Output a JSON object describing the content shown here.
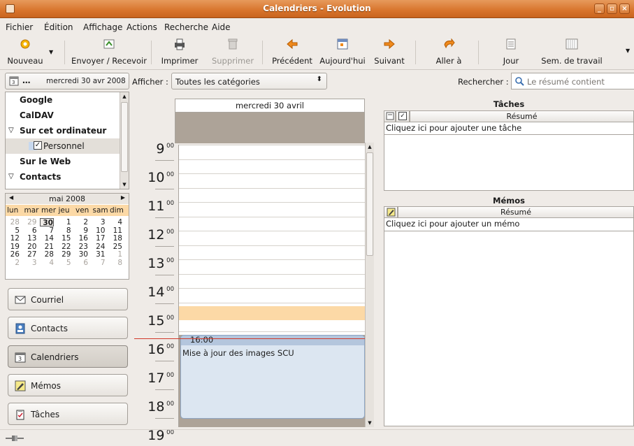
{
  "window": {
    "title": "Calendriers - Evolution"
  },
  "menu": [
    "Fichier",
    "Édition",
    "Affichage",
    "Actions",
    "Recherche",
    "Aide"
  ],
  "toolbar": {
    "new_label": "Nouveau",
    "send_receive_label": "Envoyer / Recevoir",
    "print_label": "Imprimer",
    "delete_label": "Supprimer",
    "previous_label": "Précédent",
    "today_label": "Aujourd'hui",
    "next_label": "Suivant",
    "goto_label": "Aller à",
    "day_label": "Jour",
    "workweek_label": "Sem. de travail"
  },
  "filter": {
    "date_button": "…",
    "current_date": "mercredi 30 avr 2008",
    "show_label": "Afficher :",
    "category_value": "Toutes les catégories",
    "search_label": "Rechercher :",
    "search_scope": "Le résumé contient"
  },
  "sources": [
    {
      "label": "Google",
      "type": "group",
      "expanded": false
    },
    {
      "label": "CalDAV",
      "type": "group",
      "expanded": false
    },
    {
      "label": "Sur cet ordinateur",
      "type": "group",
      "expanded": true
    },
    {
      "label": "Personnel",
      "type": "calendar",
      "checked": true
    },
    {
      "label": "Sur le Web",
      "type": "group",
      "expanded": false
    },
    {
      "label": "Contacts",
      "type": "group",
      "expanded": true
    }
  ],
  "minical": {
    "month_label": "mai 2008",
    "day_headers": [
      "lun",
      "mar",
      "mer",
      "jeu",
      "ven",
      "sam",
      "dim"
    ],
    "weeks": [
      [
        "28",
        "29",
        "30",
        "1",
        "2",
        "3",
        "4"
      ],
      [
        "5",
        "6",
        "7",
        "8",
        "9",
        "10",
        "11"
      ],
      [
        "12",
        "13",
        "14",
        "15",
        "16",
        "17",
        "18"
      ],
      [
        "19",
        "20",
        "21",
        "22",
        "23",
        "24",
        "25"
      ],
      [
        "26",
        "27",
        "28",
        "29",
        "30",
        "31",
        "1"
      ],
      [
        "2",
        "3",
        "4",
        "5",
        "6",
        "7",
        "8"
      ]
    ],
    "today": "30"
  },
  "switcher": [
    {
      "label": "Courriel",
      "icon": "mail-icon",
      "active": false
    },
    {
      "label": "Contacts",
      "icon": "contacts-icon",
      "active": false
    },
    {
      "label": "Calendriers",
      "icon": "calendar-icon",
      "active": true
    },
    {
      "label": "Mémos",
      "icon": "memo-icon",
      "active": false
    },
    {
      "label": "Tâches",
      "icon": "tasks-icon",
      "active": false
    }
  ],
  "dayview": {
    "header": "mercredi 30 avril",
    "hours": [
      "9",
      "10",
      "11",
      "12",
      "13",
      "14",
      "15",
      "16",
      "17",
      "18",
      "19"
    ],
    "minutes": "00",
    "event": {
      "time": "16:00",
      "summary": "Mise à jour des images SCU"
    }
  },
  "tasks": {
    "title": "Tâches",
    "column_summary": "Résumé",
    "add_placeholder": "Cliquez ici pour ajouter une tâche"
  },
  "memos": {
    "title": "Mémos",
    "column_summary": "Résumé",
    "add_placeholder": "Cliquez ici pour ajouter un mémo"
  },
  "colors": {
    "titlebar": "#d8742c",
    "work_hours_highlight": "#fcd9a6",
    "event_bg": "#dce6f1",
    "marcus_line": "#d23a2a",
    "nonwork_gray": "#ada398"
  }
}
